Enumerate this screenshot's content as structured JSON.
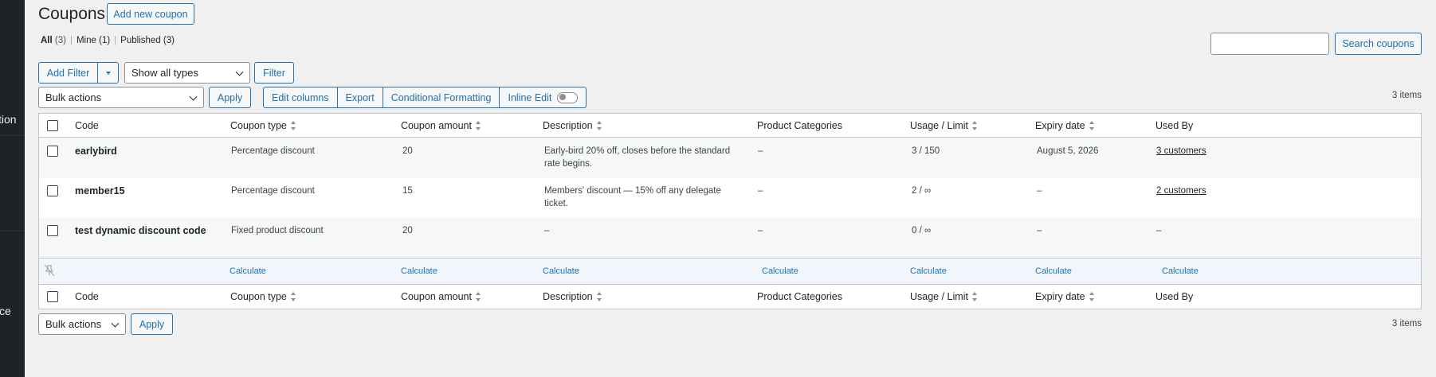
{
  "sidebar": {
    "partial_label_1": "tion",
    "partial_label_2": "ce"
  },
  "page": {
    "title": "Coupons",
    "add_new_label": "Add new coupon"
  },
  "views": [
    {
      "label": "All",
      "count": "(3)"
    },
    {
      "label": "Mine",
      "count": "(1)"
    },
    {
      "label": "Published",
      "count": "(3)"
    }
  ],
  "search": {
    "placeholder": "",
    "button_label": "Search coupons"
  },
  "filters": {
    "add_filter_label": "Add Filter",
    "type_select": "Show all types",
    "filter_button": "Filter"
  },
  "bulk_top": {
    "select": "Bulk actions",
    "apply": "Apply"
  },
  "toolbar": {
    "edit_columns": "Edit columns",
    "export": "Export",
    "conditional_formatting": "Conditional Formatting",
    "inline_edit": "Inline Edit"
  },
  "items_count": "3 items",
  "table": {
    "columns": [
      "Code",
      "Coupon type",
      "Coupon amount",
      "Description",
      "Product Categories",
      "Usage / Limit",
      "Expiry date",
      "Used By"
    ],
    "rows": [
      {
        "code": "earlybird",
        "type": "Percentage discount",
        "amount": "20",
        "description": "Early-bird 20% off, closes before the standard rate begins.",
        "categories": "–",
        "usage": "3 / 150",
        "expiry": "August 5, 2026",
        "used_by": "3 customers"
      },
      {
        "code": "member15",
        "type": "Percentage discount",
        "amount": "15",
        "description": "Members' discount — 15% off any delegate ticket.",
        "categories": "–",
        "usage": "2 / ∞",
        "expiry": "–",
        "used_by": "2 customers"
      },
      {
        "code": "test dynamic discount code",
        "type": "Fixed product discount",
        "amount": "20",
        "description": "–",
        "categories": "–",
        "usage": "0 / ∞",
        "expiry": "–",
        "used_by": "–"
      }
    ],
    "calculate_label": "Calculate"
  },
  "bulk_bottom": {
    "select": "Bulk actions",
    "apply": "Apply"
  },
  "colors": {
    "accent": "#2271b1",
    "sidebar": "#1d2327",
    "background": "#f0f0f1"
  }
}
